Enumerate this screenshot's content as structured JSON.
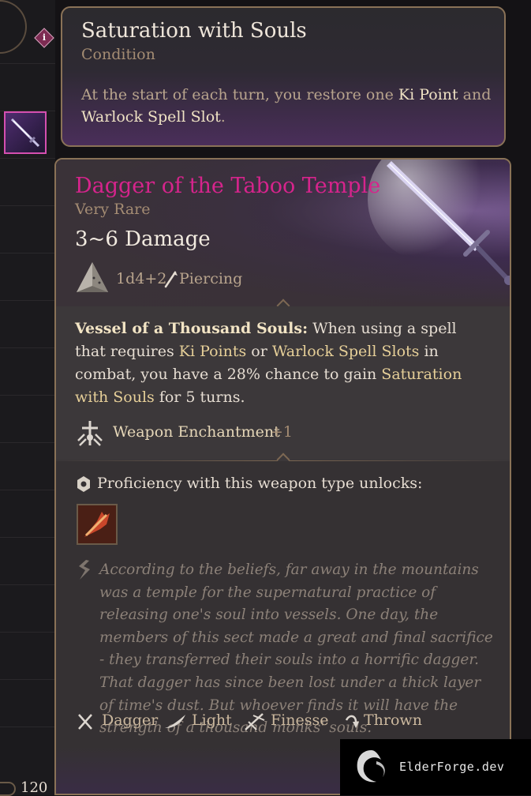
{
  "left": {
    "count": "120"
  },
  "condition": {
    "title": "Saturation with Souls",
    "type": "Condition",
    "desc_prefix": "At the start of each turn, you restore one ",
    "kw1": "Ki Point",
    "mid": " and ",
    "kw2": "Warlock Spell Slot",
    "suffix": "."
  },
  "item": {
    "name": "Dagger of the Taboo Temple",
    "rarity": "Very Rare",
    "damage": "3~6 Damage",
    "dice": "1d4+2",
    "damage_type": "Piercing",
    "passive": {
      "name": "Vessel of a Thousand Souls:",
      "t1": " When using a spell that requires ",
      "k1": "Ki Points",
      "t2": " or ",
      "k2": "Warlock Spell Slots",
      "t3": " in combat, you have a 28% chance to gain ",
      "k3": "Saturation with Souls",
      "t4": " for 5 turns."
    },
    "enchantment_label": "Weapon Enchantment",
    "enchantment_value": "+1",
    "proficiency_text": "Proficiency with this weapon type unlocks:",
    "lore": "According to the beliefs, far away in the mountains was a temple for the supernatural practice of releasing one's soul into vessels. One day, the members of this sect made a great and final sacrifice - they transferred their souls into a horrific dagger. That dagger has since been lost under a thick layer of time's dust. But whoever finds it will have the strength of a thousand monks' souls.",
    "properties": [
      "Dagger",
      "Light",
      "Finesse",
      "Thrown"
    ]
  },
  "watermark": {
    "text": "ElderForge.dev"
  },
  "colors": {
    "item_name": "#d6248c",
    "keyword": "#e6cf98",
    "border": "#8a7257"
  },
  "icons": {
    "info": "info-icon",
    "die": "d4-die-icon",
    "piercing": "piercing-icon",
    "enchant": "weapon-enchantment-icon",
    "proficiency": "proficiency-icon",
    "lore": "lore-quote-icon",
    "properties": [
      "dagger-icon",
      "light-icon",
      "finesse-icon",
      "thrown-icon"
    ]
  }
}
